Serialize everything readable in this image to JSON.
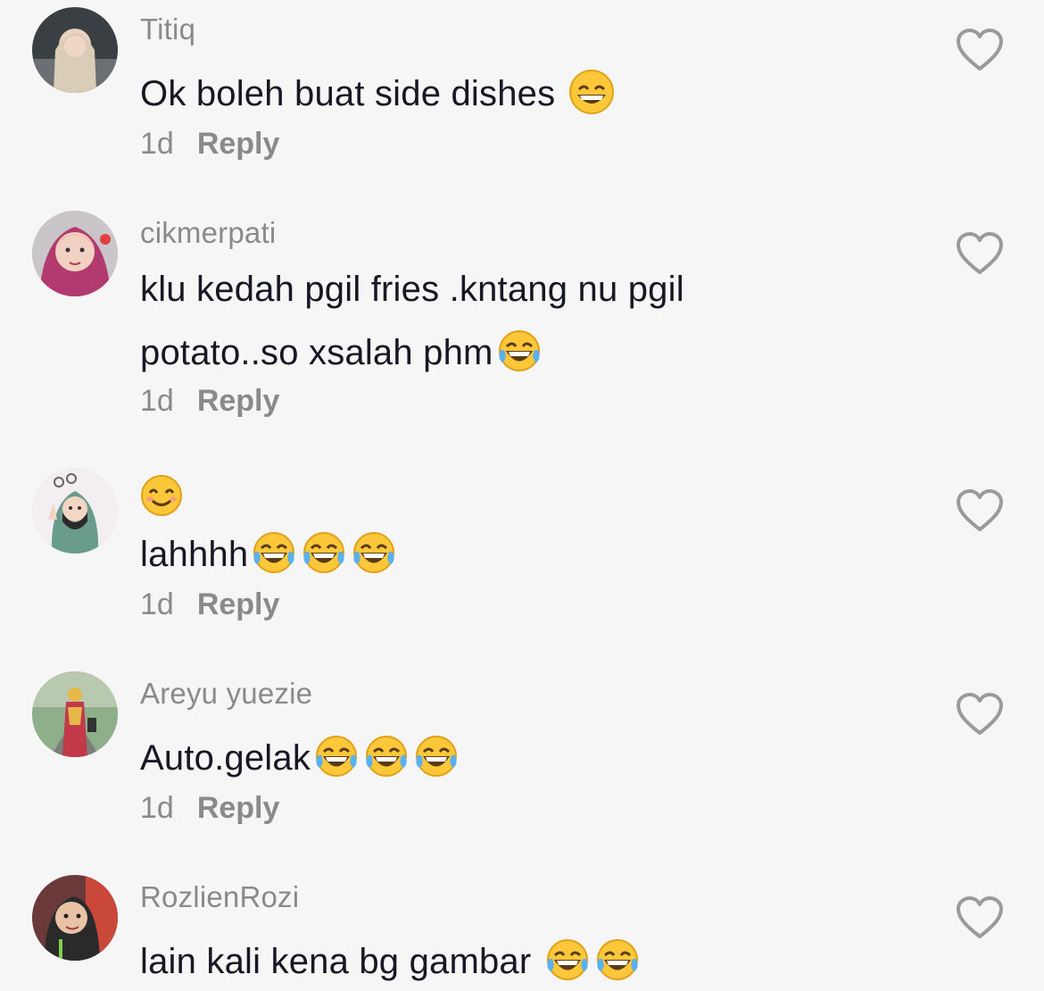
{
  "comments": [
    {
      "username": "Titiq",
      "lines": [
        "Ok boleh buat side dishes "
      ],
      "emojis": [
        "grinning"
      ],
      "time": "1d",
      "reply_label": "Reply",
      "avatar": "avatar-titiq"
    },
    {
      "username": "cikmerpati",
      "lines": [
        "klu kedah pgil fries .kntang nu pgil",
        "potato..so xsalah phm"
      ],
      "emojis": [
        "tears-of-joy"
      ],
      "time": "1d",
      "reply_label": "Reply",
      "avatar": "avatar-cikmerpati"
    },
    {
      "username": "",
      "lines": [
        "lahhhh"
      ],
      "top_emoji": "smiling",
      "emojis": [
        "tears-of-joy",
        "tears-of-joy",
        "tears-of-joy"
      ],
      "time": "1d",
      "reply_label": "Reply",
      "avatar": "avatar-third"
    },
    {
      "username": "Areyu yuezie",
      "lines": [
        "Auto.gelak"
      ],
      "emojis": [
        "tears-of-joy",
        "tears-of-joy",
        "tears-of-joy"
      ],
      "time": "1d",
      "reply_label": "Reply",
      "avatar": "avatar-areyu"
    },
    {
      "username": "RozlienRozi",
      "lines": [
        "lain kali kena bg gambar "
      ],
      "emojis": [
        "tears-of-joy",
        "tears-of-joy"
      ],
      "avatar": "avatar-rozlien"
    }
  ],
  "icons": {
    "like": "heart-outline-icon"
  },
  "colors": {
    "background": "#f6f6f6",
    "text": "#161823",
    "muted": "#8a8a8a"
  }
}
